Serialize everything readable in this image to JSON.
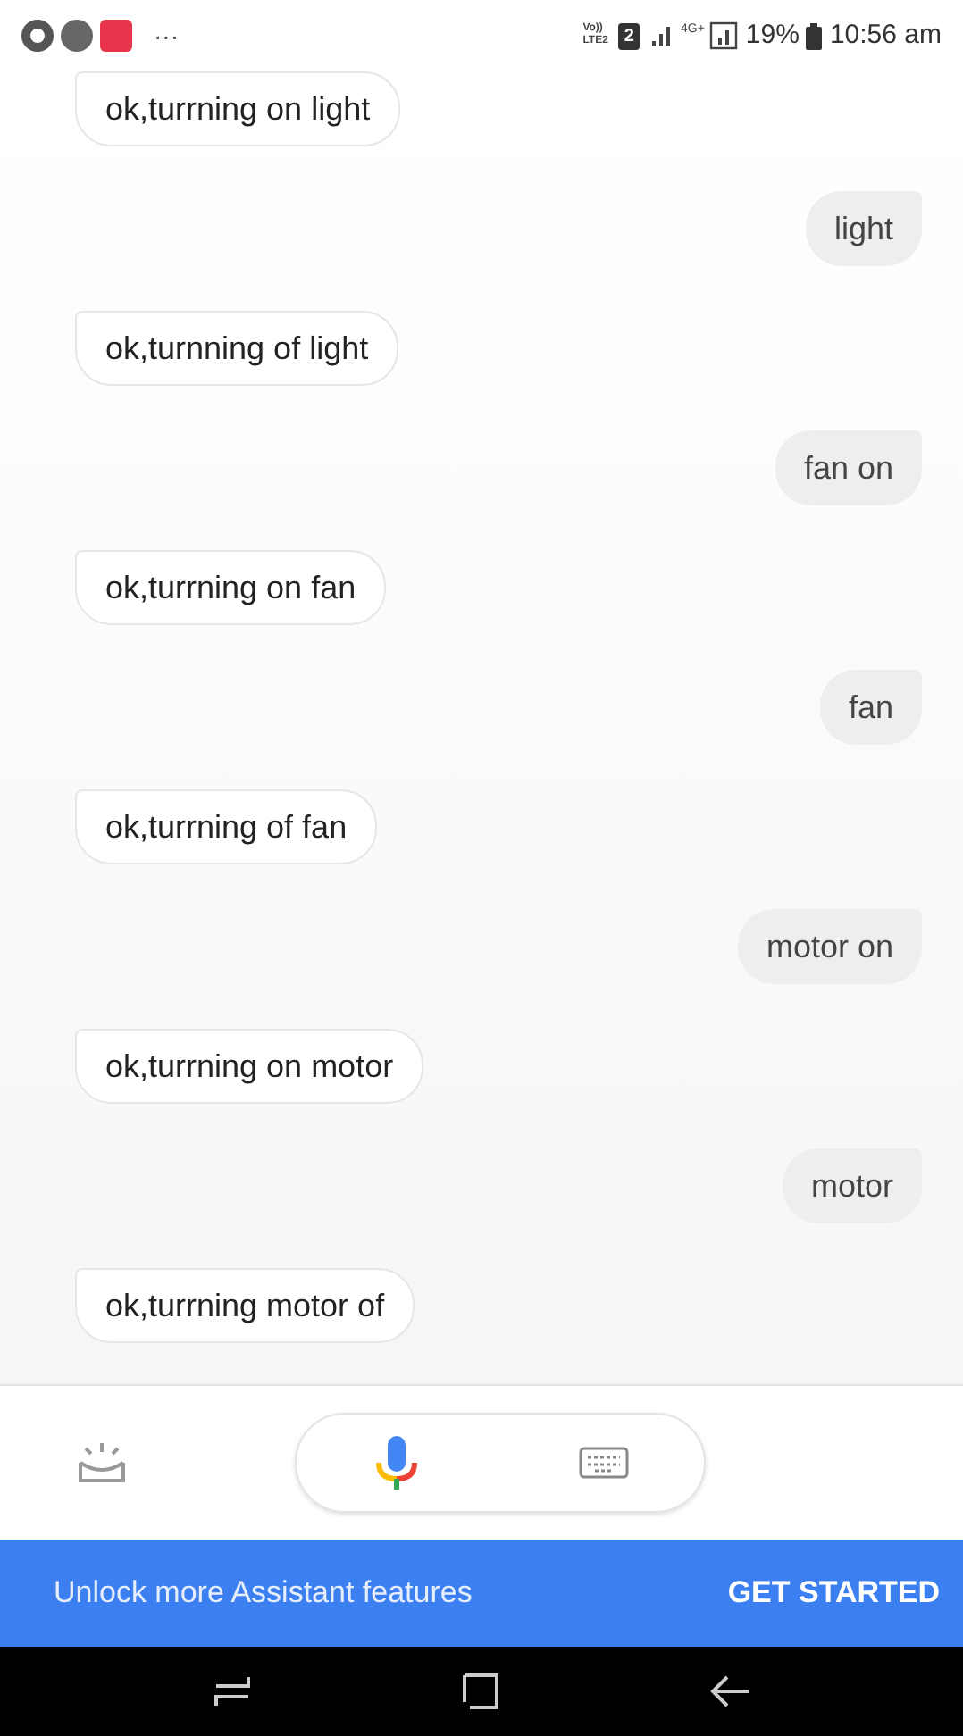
{
  "status_bar": {
    "more": "···",
    "network_labels": [
      "Vo))\nLTE2",
      "2",
      "4G+"
    ],
    "battery": "19%",
    "time": "10:56 am"
  },
  "messages": [
    {
      "kind": "assistant",
      "text": "ok,turrning on light"
    },
    {
      "kind": "user",
      "text": "light"
    },
    {
      "kind": "assistant",
      "text": "ok,turnning of light"
    },
    {
      "kind": "user",
      "text": "fan on"
    },
    {
      "kind": "assistant",
      "text": "ok,turrning on fan"
    },
    {
      "kind": "user",
      "text": "fan"
    },
    {
      "kind": "assistant",
      "text": "ok,turrning of fan"
    },
    {
      "kind": "user",
      "text": "motor on"
    },
    {
      "kind": "assistant",
      "text": "ok,turrning on motor"
    },
    {
      "kind": "user",
      "text": "motor"
    },
    {
      "kind": "assistant",
      "text": "ok,turrning motor of"
    }
  ],
  "banner": {
    "text": "Unlock more Assistant features",
    "action": "GET STARTED"
  }
}
